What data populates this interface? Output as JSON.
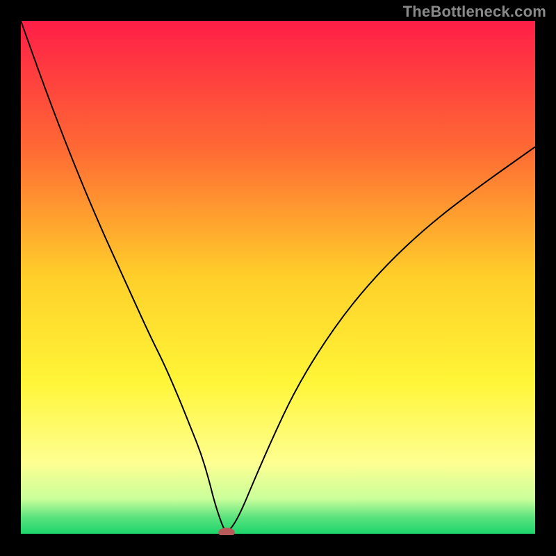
{
  "watermark": "TheBottleneck.com",
  "chart_data": {
    "type": "line",
    "title": "",
    "xlabel": "",
    "ylabel": "",
    "xlim": [
      0,
      100
    ],
    "ylim": [
      0,
      100
    ],
    "grid": false,
    "annotations": [],
    "background_gradient": {
      "stops": [
        {
          "pos": 0.0,
          "color": "#ff1e47"
        },
        {
          "pos": 0.25,
          "color": "#ff6a34"
        },
        {
          "pos": 0.5,
          "color": "#ffd02a"
        },
        {
          "pos": 0.7,
          "color": "#fff537"
        },
        {
          "pos": 0.86,
          "color": "#feff92"
        },
        {
          "pos": 0.93,
          "color": "#c9ff9a"
        },
        {
          "pos": 0.965,
          "color": "#5be27e"
        },
        {
          "pos": 1.0,
          "color": "#17d46a"
        }
      ]
    },
    "series": [
      {
        "name": "bottleneck-curve",
        "color": "#000000",
        "x": [
          0,
          5,
          10,
          15,
          20,
          25,
          28,
          31,
          33,
          35,
          36.5,
          37.5,
          38.5,
          39.3,
          40.0,
          41.3,
          43.0,
          45.5,
          49.0,
          53.0,
          58.0,
          64.0,
          71.0,
          79.0,
          88.0,
          100.0
        ],
        "y": [
          100,
          86,
          73,
          61,
          50,
          39,
          33,
          26,
          21,
          16,
          11,
          7,
          3.8,
          1.6,
          0.5,
          1.8,
          5.0,
          11.0,
          19.0,
          27.5,
          36.0,
          44.5,
          52.5,
          60.0,
          67.0,
          75.5
        ]
      }
    ],
    "marker": {
      "name": "optimal-point",
      "x": 40.0,
      "y": 0.0,
      "color": "#b85a5a",
      "rx": 1.6,
      "ry": 0.9
    },
    "frame": {
      "outer_w": 800,
      "outer_h": 800,
      "inner_left": 30,
      "inner_top": 30,
      "inner_w": 740,
      "inner_h": 740
    }
  }
}
